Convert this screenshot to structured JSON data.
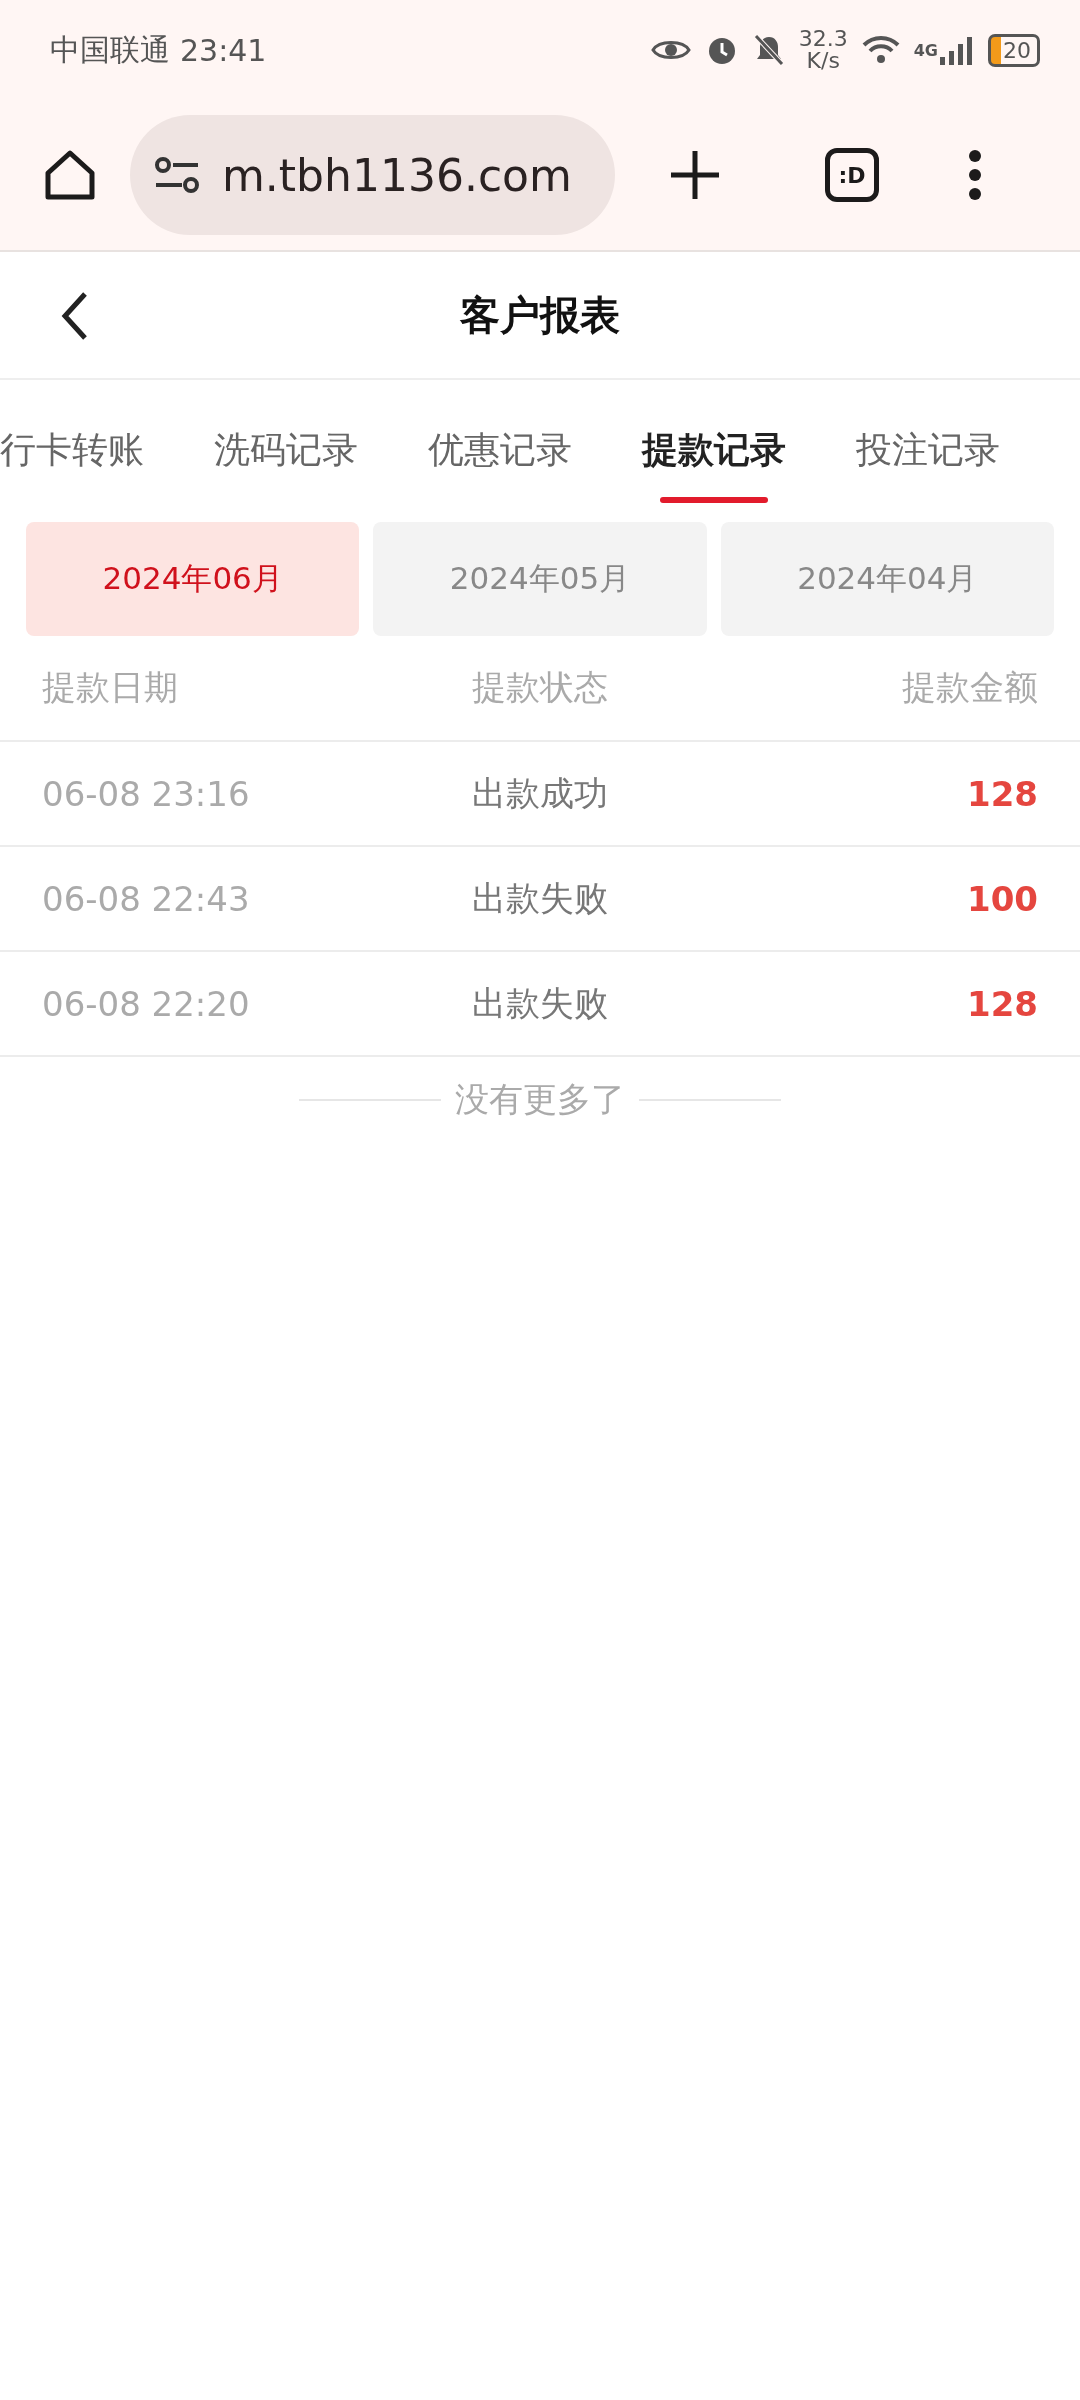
{
  "status_bar": {
    "carrier": "中国联通",
    "time": "23:41",
    "speed_value": "32.3",
    "speed_unit": "K/s",
    "network": "4G",
    "battery": "20"
  },
  "browser": {
    "url": "m.tbh1136.com",
    "tab_switcher": ":D"
  },
  "header": {
    "title": "客户报表"
  },
  "tabs": [
    {
      "label": "行卡转账",
      "selected": false
    },
    {
      "label": "洗码记录",
      "selected": false
    },
    {
      "label": "优惠记录",
      "selected": false
    },
    {
      "label": "提款记录",
      "selected": true
    },
    {
      "label": "投注记录",
      "selected": false
    }
  ],
  "months": [
    {
      "label": "2024年06月",
      "selected": true
    },
    {
      "label": "2024年05月",
      "selected": false
    },
    {
      "label": "2024年04月",
      "selected": false
    }
  ],
  "table": {
    "columns": [
      "提款日期",
      "提款状态",
      "提款金额"
    ],
    "rows": [
      {
        "date": "06-08 23:16",
        "status": "出款成功",
        "amount": "128"
      },
      {
        "date": "06-08 22:43",
        "status": "出款失败",
        "amount": "100"
      },
      {
        "date": "06-08 22:20",
        "status": "出款失败",
        "amount": "128"
      }
    ]
  },
  "footer": "没有更多了"
}
